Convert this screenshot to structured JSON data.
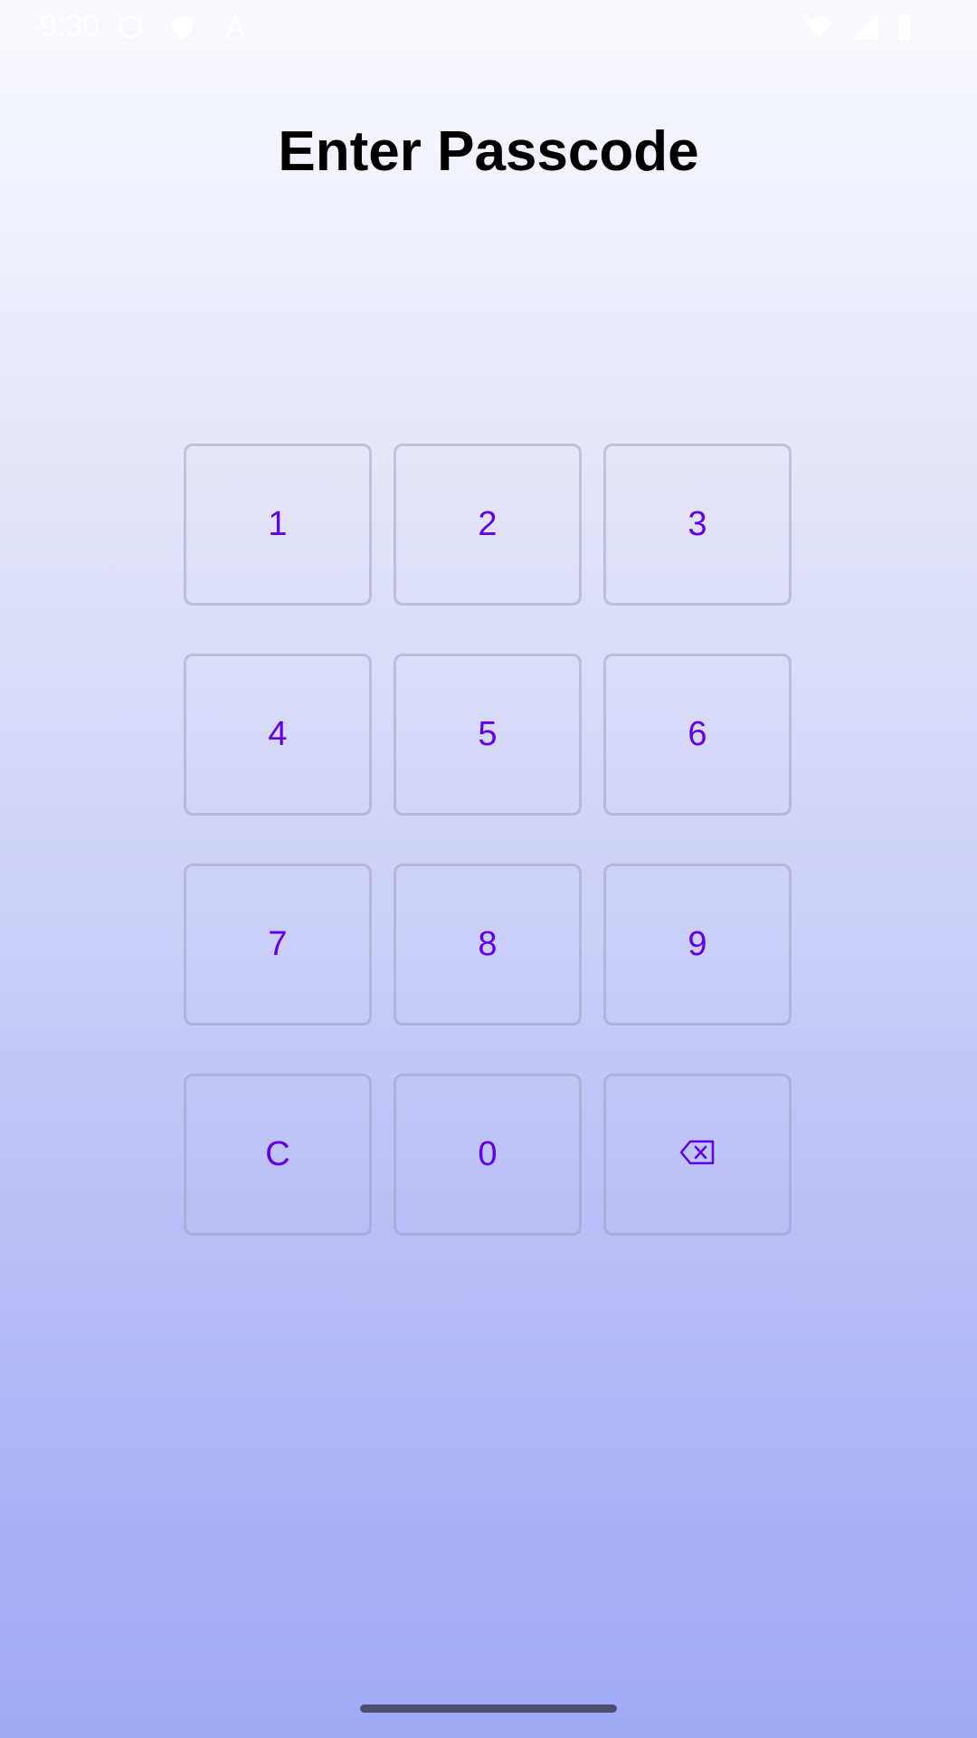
{
  "status_bar": {
    "time": "9:30",
    "icons": [
      "data-saver-icon",
      "shield-icon",
      "font-a-icon",
      "wifi-icon",
      "signal-icon",
      "battery-icon"
    ]
  },
  "title": "Enter Passcode",
  "keypad": {
    "keys": [
      {
        "label": "1"
      },
      {
        "label": "2"
      },
      {
        "label": "3"
      },
      {
        "label": "4"
      },
      {
        "label": "5"
      },
      {
        "label": "6"
      },
      {
        "label": "7"
      },
      {
        "label": "8"
      },
      {
        "label": "9"
      },
      {
        "label": "C"
      },
      {
        "label": "0"
      },
      {
        "icon": "backspace-icon"
      }
    ]
  },
  "colors": {
    "accent": "#6200ee",
    "title": "#000000",
    "home_indicator": "#4b4e6e"
  }
}
